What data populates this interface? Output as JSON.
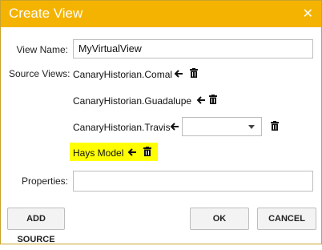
{
  "window": {
    "title": "Create View",
    "close_glyph": "✕"
  },
  "form": {
    "view_name_label": "View Name:",
    "view_name_value": "MyVirtualView",
    "source_views_label": "Source Views:",
    "properties_label": "Properties:",
    "properties_value": ""
  },
  "sources": [
    {
      "name": "CanaryHistorian.Comal"
    },
    {
      "name": "CanaryHistorian.Guadalupe"
    },
    {
      "name": "CanaryHistorian.Travis",
      "selected_value": ""
    },
    {
      "name": "Hays Model",
      "highlight_color": "#ffff00"
    }
  ],
  "buttons": {
    "add_source": "ADD SOURCE",
    "ok": "OK",
    "cancel": "CANCEL"
  },
  "colors": {
    "titlebar": "#f5b301",
    "highlight": "#ffff00"
  },
  "icons": [
    "close-icon",
    "arrow-left-icon",
    "trash-icon",
    "chevron-down-icon"
  ]
}
